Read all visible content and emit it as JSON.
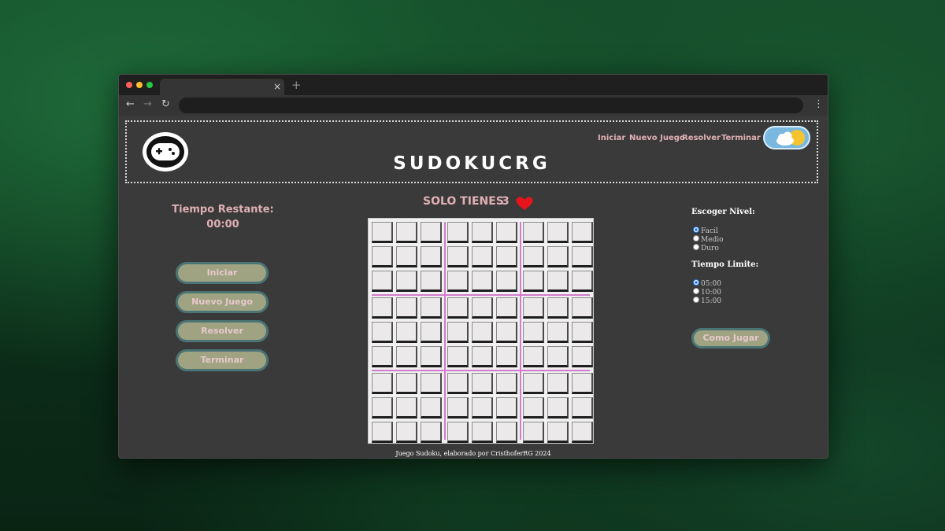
{
  "browser": {
    "tab_close": "×",
    "new_tab": "+",
    "back": "←",
    "forward": "→",
    "reload": "↻",
    "menu": "⋮"
  },
  "header": {
    "title": "SUDOKUCRG",
    "nav": [
      "Iniciar",
      "Nuevo Juego",
      "Resolver",
      "Terminar"
    ]
  },
  "timer": {
    "label": "Tiempo Restante:",
    "value": "00:00"
  },
  "buttons": [
    "Iniciar",
    "Nuevo Juego",
    "Resolver",
    "Terminar"
  ],
  "lives": {
    "text": "SOLO TIENES",
    "count": "3"
  },
  "board": {
    "rows": 9,
    "cols": 9
  },
  "level": {
    "label": "Escoger Nivel:",
    "options": [
      "Facil",
      "Medio",
      "Duro"
    ],
    "selected": "Facil"
  },
  "time_limit": {
    "label": "Tiempo Limite:",
    "options": [
      "05:00",
      "10:00",
      "15:00"
    ],
    "selected": "05:00"
  },
  "how_to_play": "Como Jugar",
  "footer": "Juego Sudoku, elaborado por CristhoferRG 2024",
  "colors": {
    "accent_text": "#e0b0b6",
    "button_fill": "#9fa382",
    "button_border": "#4b7474",
    "board_separator": "#d27bcf",
    "heart": "#e8141c"
  }
}
